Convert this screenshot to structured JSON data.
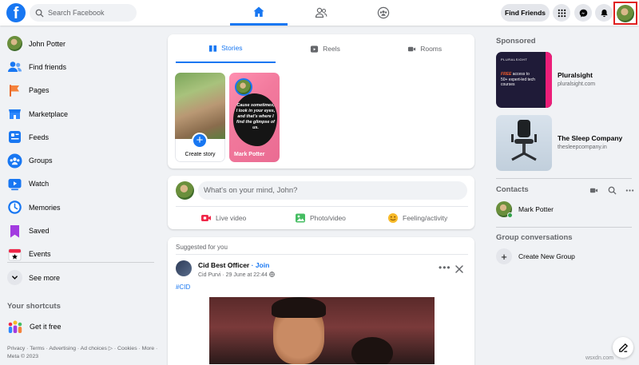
{
  "colors": {
    "brand": "#1877f2",
    "online": "#31a24c",
    "highlight_box": "#e01e1e"
  },
  "topbar": {
    "logo": "f",
    "search_placeholder": "Search Facebook",
    "nav_tabs": [
      {
        "icon": "home-icon",
        "active": true
      },
      {
        "icon": "friends-icon",
        "active": false
      },
      {
        "icon": "groups-icon",
        "active": false
      }
    ],
    "find_friends_label": "Find Friends",
    "right_icons": [
      "menu-grid-icon",
      "messenger-icon",
      "bell-icon",
      "profile-avatar"
    ]
  },
  "sidebar": {
    "items": [
      {
        "label": "John Potter",
        "icon": "profile-avatar"
      },
      {
        "label": "Find friends",
        "icon": "friends-icon"
      },
      {
        "label": "Pages",
        "icon": "flag-icon"
      },
      {
        "label": "Marketplace",
        "icon": "store-icon"
      },
      {
        "label": "Feeds",
        "icon": "feeds-icon"
      },
      {
        "label": "Groups",
        "icon": "groups-icon"
      },
      {
        "label": "Watch",
        "icon": "watch-icon"
      },
      {
        "label": "Memories",
        "icon": "clock-icon"
      },
      {
        "label": "Saved",
        "icon": "bookmark-icon"
      },
      {
        "label": "Events",
        "icon": "calendar-icon"
      },
      {
        "label": "See more",
        "icon": "chevron-down-icon"
      }
    ],
    "shortcuts_heading": "Your shortcuts",
    "shortcuts": [
      {
        "label": "Get it free",
        "icon": "people-group-icon"
      }
    ],
    "footer": "Privacy · Terms · Advertising · Ad choices ▷ · Cookies · More · Meta © 2023"
  },
  "stories": {
    "tabs": [
      {
        "label": "Stories",
        "icon": "book-icon",
        "active": true
      },
      {
        "label": "Reels",
        "icon": "reels-icon",
        "active": false
      },
      {
        "label": "Rooms",
        "icon": "video-icon",
        "active": false
      }
    ],
    "create_label": "Create story",
    "friend_story": {
      "name": "Mark Potter",
      "quote": "Cause sometimes, I look in your eyes, and that's where I find the glimpse of us."
    }
  },
  "composer": {
    "placeholder": "What's on your mind, John?",
    "actions": [
      {
        "label": "Live video",
        "icon": "live-video-icon",
        "color": "#f02849"
      },
      {
        "label": "Photo/video",
        "icon": "photo-icon",
        "color": "#45bd62"
      },
      {
        "label": "Feeling/activity",
        "icon": "smiley-icon",
        "color": "#f7b928"
      }
    ]
  },
  "post": {
    "suggested": "Suggested for you",
    "page_name": "Cid Best Officer",
    "join_sep": " · ",
    "join": "Join",
    "author": "Cid Purvi",
    "date": "29 June at 22:44",
    "hashtag": "#CID"
  },
  "right": {
    "sponsored_heading": "Sponsored",
    "ads": [
      {
        "title": "Pluralsight",
        "url": "pluralsight.com",
        "thumb_logo": "PLURALSIGHT",
        "thumb_free": "FREE",
        "thumb_copy": " access to 50+ expert-led tech courses"
      },
      {
        "title": "The Sleep Company",
        "url": "thesleepcompany.in"
      }
    ],
    "contacts_heading": "Contacts",
    "contacts": [
      {
        "name": "Mark Potter",
        "online": true
      }
    ],
    "groups_heading": "Group conversations",
    "create_group": "Create New Group"
  },
  "watermark": "wsxdn.com"
}
